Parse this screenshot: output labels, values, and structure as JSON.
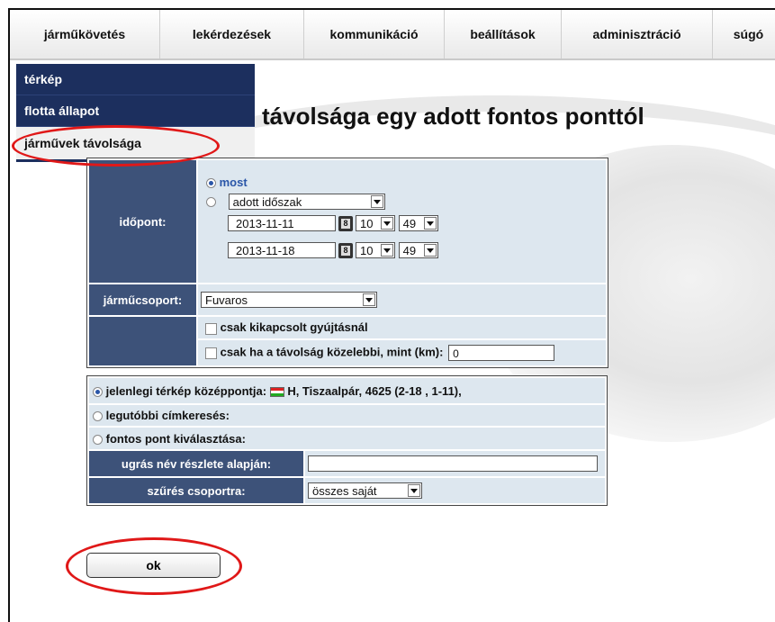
{
  "menu": {
    "tabs": [
      {
        "label": "járműkövetés"
      },
      {
        "label": "lekérdezések"
      },
      {
        "label": "kommunikáció"
      },
      {
        "label": "beállítások"
      },
      {
        "label": "adminisztráció"
      },
      {
        "label": "súgó"
      }
    ]
  },
  "dropdown": {
    "items": [
      {
        "label": "térkép"
      },
      {
        "label": "flotta állapot"
      },
      {
        "label": "járművek távolsága"
      }
    ],
    "active_index": 2
  },
  "page_title": "távolsága egy adott fontos ponttól",
  "form": {
    "time_label": "időpont:",
    "now_label": "most",
    "period_select": "adott időszak",
    "start_date": "2013-11-11",
    "start_hour": "10",
    "start_minute": "49",
    "end_date": "2013-11-18",
    "end_hour": "10",
    "end_minute": "49",
    "group_label": "járműcsoport:",
    "group_select": "Fuvaros",
    "ignition_off_label": "csak kikapcsolt gyújtásnál",
    "distance_label": "csak ha a távolság közelebbi, mint (km):",
    "distance_value": "0"
  },
  "location": {
    "map_center_label": "jelenlegi térkép középpontja:",
    "map_center_value": "H, Tiszaalpár, 4625 (2-18 , 1-11),",
    "last_address_label": "legutóbbi címkeresés:",
    "poi_select_label": "fontos pont kiválasztása:",
    "jump_label": "ugrás név részlete alapján:",
    "jump_value": "",
    "filter_label": "szűrés csoportra:",
    "filter_select": "összes saját"
  },
  "ok_label": "ok",
  "colors": {
    "menu_dark": "#1c2f5e",
    "label_bg": "#3d5279",
    "value_bg": "#dde7ef",
    "highlight_red": "#e01818"
  }
}
